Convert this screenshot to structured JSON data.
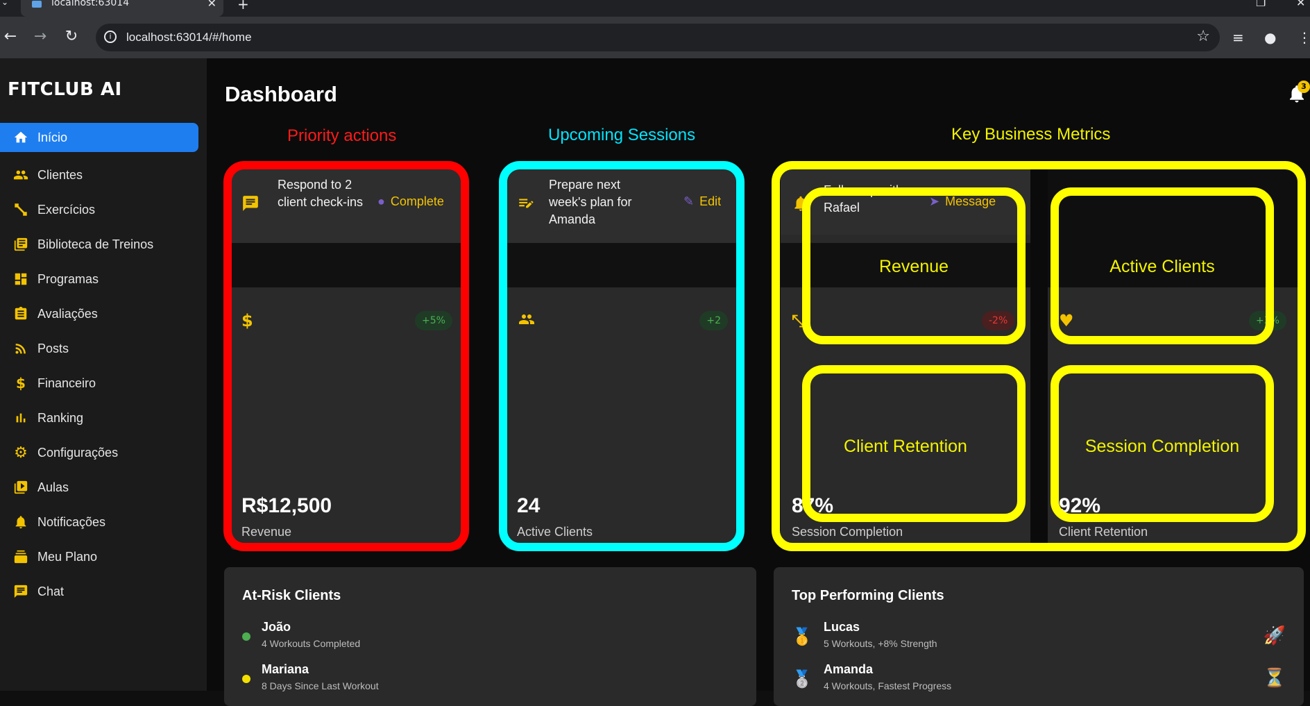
{
  "browser": {
    "tab_title": "localhost:63014",
    "url": "localhost:63014/#/home"
  },
  "sidebar": {
    "brand": "FITCLUB AI",
    "items": [
      {
        "label": "Início",
        "icon": "home-icon",
        "active": true
      },
      {
        "label": "Clientes",
        "icon": "users-icon"
      },
      {
        "label": "Exercícios",
        "icon": "dumbbell-icon"
      },
      {
        "label": "Biblioteca de Treinos",
        "icon": "library-icon"
      },
      {
        "label": "Programas",
        "icon": "dashboard-icon"
      },
      {
        "label": "Avaliações",
        "icon": "clipboard-icon"
      },
      {
        "label": "Posts",
        "icon": "rss-icon"
      },
      {
        "label": "Financeiro",
        "icon": "dollar-icon"
      },
      {
        "label": "Ranking",
        "icon": "bar-chart-icon"
      },
      {
        "label": "Configurações",
        "icon": "gear-icon"
      },
      {
        "label": "Aulas",
        "icon": "video-library-icon"
      },
      {
        "label": "Notificações",
        "icon": "bell-icon"
      },
      {
        "label": "Meu Plano",
        "icon": "stack-icon"
      },
      {
        "label": "Chat",
        "icon": "chat-icon"
      }
    ]
  },
  "header": {
    "title": "Dashboard",
    "notification_count": "3"
  },
  "sections": {
    "priority": "Priority actions",
    "upcoming": "Upcoming Sessions",
    "metrics": "Key Business Metrics"
  },
  "cards": [
    {
      "action_text": "Respond to 2 client check-ins",
      "action_button": "Complete",
      "stat_icon": "$",
      "chip": "+5%",
      "value": "R$12,500",
      "label": "Revenue"
    },
    {
      "action_text": "Prepare next week's plan for Amanda",
      "action_button": "Edit",
      "chip": "+2",
      "value": "24",
      "label": "Active Clients"
    },
    {
      "action_text": "Follow up with Rafael",
      "action_button": "Message",
      "chip": "-2%",
      "value": "87%",
      "label": "Session Completion"
    },
    {
      "chip": "+3%",
      "value": "92%",
      "label": "Client Retention"
    }
  ],
  "overlay_labels": {
    "revenue": "Revenue",
    "active_clients": "Active Clients",
    "client_retention": "Client Retention",
    "session_completion": "Session Completion"
  },
  "colors": {
    "accent_yellow": "#f3c300",
    "active_blue": "#1e7ef0",
    "frame_red": "#ff0000",
    "frame_cyan": "#00ffff",
    "frame_yellow": "#ffff00"
  },
  "at_risk": {
    "title": "At-Risk Clients",
    "rows": [
      {
        "name": "João",
        "desc": "4 Workouts Completed",
        "status_color": "#4caf50"
      },
      {
        "name": "Mariana",
        "desc": "8 Days Since Last Workout",
        "status_color": "#f3e000"
      }
    ]
  },
  "top_performing": {
    "title": "Top Performing Clients",
    "rows": [
      {
        "name": "Lucas",
        "desc": "5 Workouts, +8% Strength",
        "medal": "🥇",
        "end_icon": "🚀"
      },
      {
        "name": "Amanda",
        "desc": "4 Workouts, Fastest Progress",
        "medal": "🥈",
        "end_icon": "⏳"
      }
    ]
  }
}
